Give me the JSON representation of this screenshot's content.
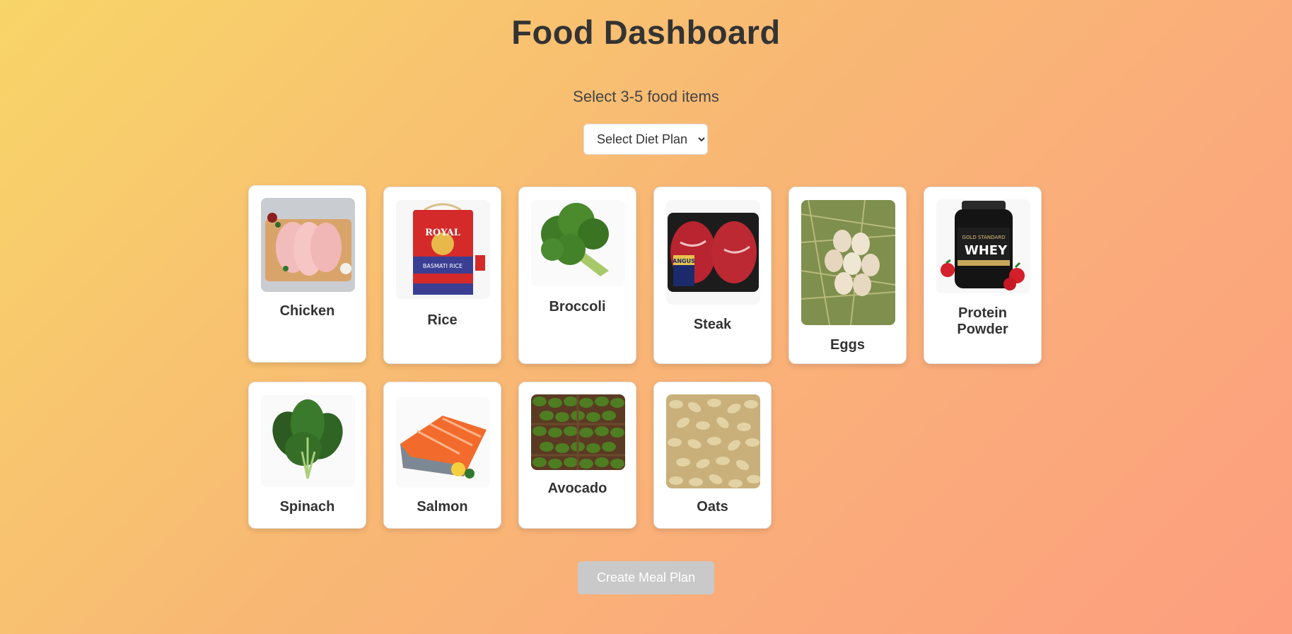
{
  "header": {
    "title": "Food Dashboard",
    "subtitle": "Select 3-5 food items"
  },
  "diet_select": {
    "selected": "Select Diet Plan"
  },
  "foods": [
    {
      "name": "Chicken",
      "icon": "chicken-image"
    },
    {
      "name": "Rice",
      "icon": "rice-bag-image"
    },
    {
      "name": "Broccoli",
      "icon": "broccoli-image"
    },
    {
      "name": "Steak",
      "icon": "steak-image"
    },
    {
      "name": "Eggs",
      "icon": "eggs-image"
    },
    {
      "name": "Protein Powder",
      "icon": "protein-powder-image"
    },
    {
      "name": "Spinach",
      "icon": "spinach-image"
    },
    {
      "name": "Salmon",
      "icon": "salmon-image"
    },
    {
      "name": "Avocado",
      "icon": "avocado-image"
    },
    {
      "name": "Oats",
      "icon": "oats-image"
    }
  ],
  "image_lettering": {
    "rice_bag": [
      "ROYAL",
      "BASMATI RICE"
    ],
    "steak_label": [
      "ANGUS"
    ],
    "protein_tub": [
      "GOLD STANDARD",
      "WHEY"
    ]
  },
  "actions": {
    "create_label": "Create Meal Plan"
  },
  "colors": {
    "background_start": "#f8d568",
    "background_end": "#fd9e7e",
    "card": "#ffffff",
    "button_disabled": "#c9c9c9"
  }
}
